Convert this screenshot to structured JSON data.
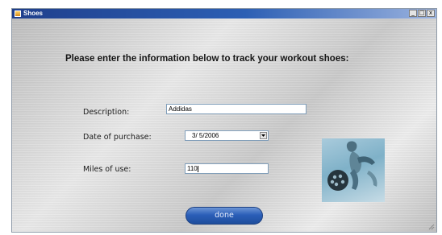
{
  "window": {
    "title": "Shoes",
    "controls": {
      "minimize": "_",
      "maximize": "□",
      "close": "x"
    }
  },
  "form": {
    "heading": "Please enter the information below to track your workout shoes:",
    "description": {
      "label": "Description:",
      "value": "Addidas"
    },
    "date_of_purchase": {
      "label": "Date of purchase:",
      "value": "3/ 5/2006"
    },
    "miles_of_use": {
      "label": "Miles of use:",
      "value": "110"
    },
    "done_label": "done"
  },
  "icons": {
    "app": "window-app-icon",
    "dropdown": "chevron-down-icon",
    "photo": "runner-photo",
    "resize": "resize-grip-icon"
  }
}
